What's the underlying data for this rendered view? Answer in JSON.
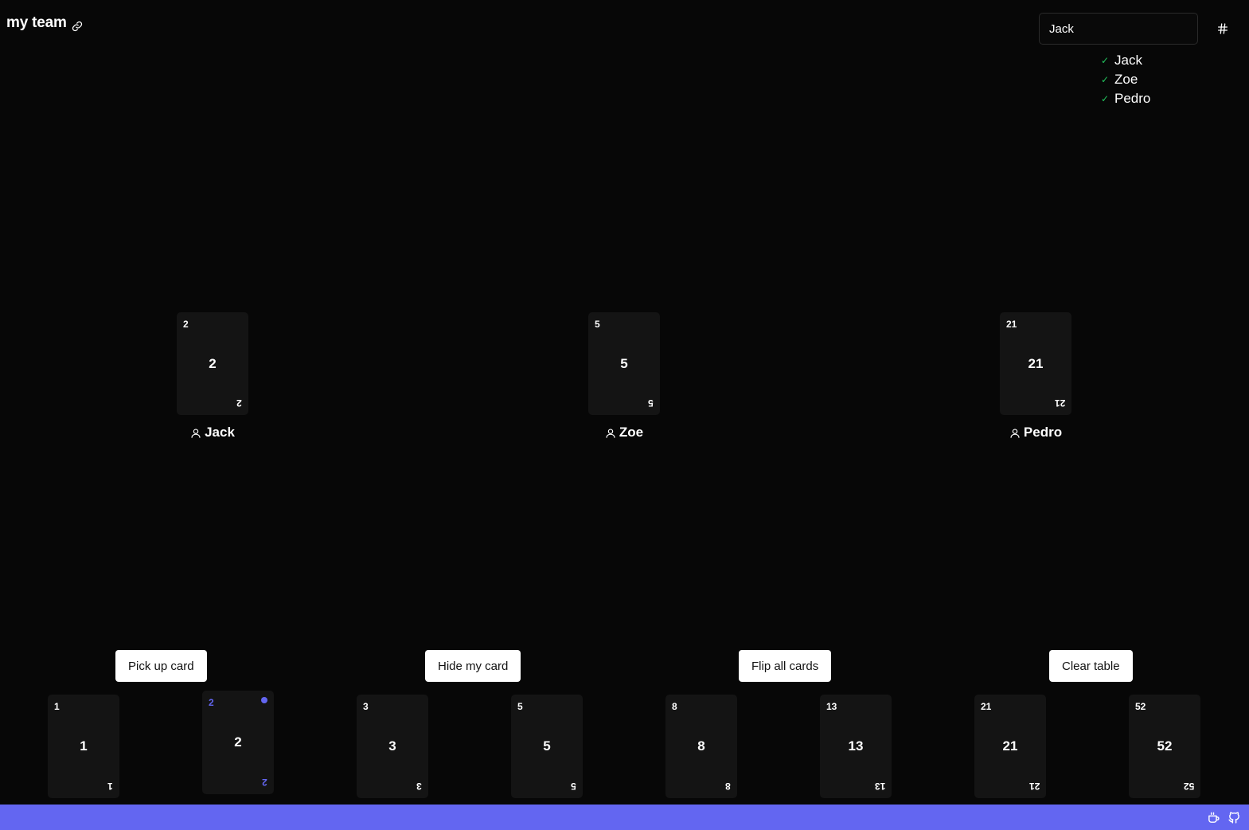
{
  "header": {
    "team_name": "my team",
    "link_icon": "link-icon",
    "name_input_value": "Jack",
    "hash_icon": "hash-icon"
  },
  "players": [
    {
      "name": "Jack",
      "status_icon": "check-icon"
    },
    {
      "name": "Zoe",
      "status_icon": "check-icon"
    },
    {
      "name": "Pedro",
      "status_icon": "check-icon"
    }
  ],
  "table": [
    {
      "player": "Jack",
      "card": "2",
      "icon": "user-icon"
    },
    {
      "player": "Zoe",
      "card": "5",
      "icon": "user-icon"
    },
    {
      "player": "Pedro",
      "card": "21",
      "icon": "user-icon"
    }
  ],
  "actions": {
    "pick_up": "Pick up card",
    "hide": "Hide my card",
    "flip": "Flip all cards",
    "clear": "Clear table"
  },
  "hand": [
    {
      "value": "1",
      "selected": false
    },
    {
      "value": "2",
      "selected": true
    },
    {
      "value": "3",
      "selected": false
    },
    {
      "value": "5",
      "selected": false
    },
    {
      "value": "8",
      "selected": false
    },
    {
      "value": "13",
      "selected": false
    },
    {
      "value": "21",
      "selected": false
    },
    {
      "value": "52",
      "selected": false
    }
  ],
  "footer": {
    "icons": [
      "coffee-icon",
      "github-icon"
    ]
  },
  "colors": {
    "background": "#070707",
    "card": "#141414",
    "accent": "#6366f1",
    "check": "#22c55e",
    "button": "#ffffff"
  }
}
